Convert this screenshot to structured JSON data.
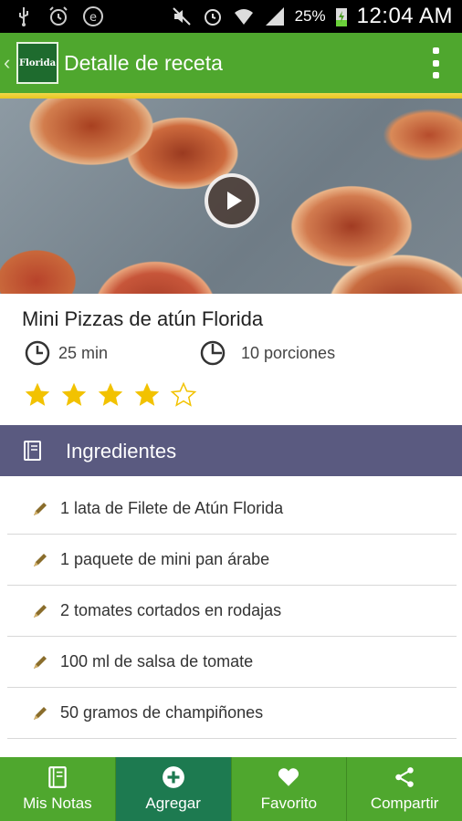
{
  "status_bar": {
    "battery": "25%",
    "time": "12:04 AM"
  },
  "appbar": {
    "logo_text": "Florida",
    "title": "Detalle de receta"
  },
  "recipe": {
    "title": "Mini Pizzas de atún Florida",
    "time": "25 min",
    "portions": "10 porciones",
    "rating": 4,
    "rating_max": 5
  },
  "ingredients": {
    "header": "Ingredientes",
    "items": [
      "1 lata de Filete de Atún Florida",
      "1 paquete de mini pan árabe",
      "2 tomates cortados en rodajas",
      "100 ml de salsa de tomate",
      "50 gramos de champiñones"
    ]
  },
  "bottom_nav": {
    "tabs": [
      {
        "label": "Mis Notas",
        "icon": "notes-icon",
        "active": false
      },
      {
        "label": "Agregar",
        "icon": "add-circle-icon",
        "active": true
      },
      {
        "label": "Favorito",
        "icon": "heart-icon",
        "active": false
      },
      {
        "label": "Compartir",
        "icon": "share-icon",
        "active": false
      }
    ]
  },
  "colors": {
    "brand_green": "#4fa72e",
    "active_tab": "#1d7a50",
    "section_header": "#5a5a80",
    "star": "#f2c200"
  }
}
